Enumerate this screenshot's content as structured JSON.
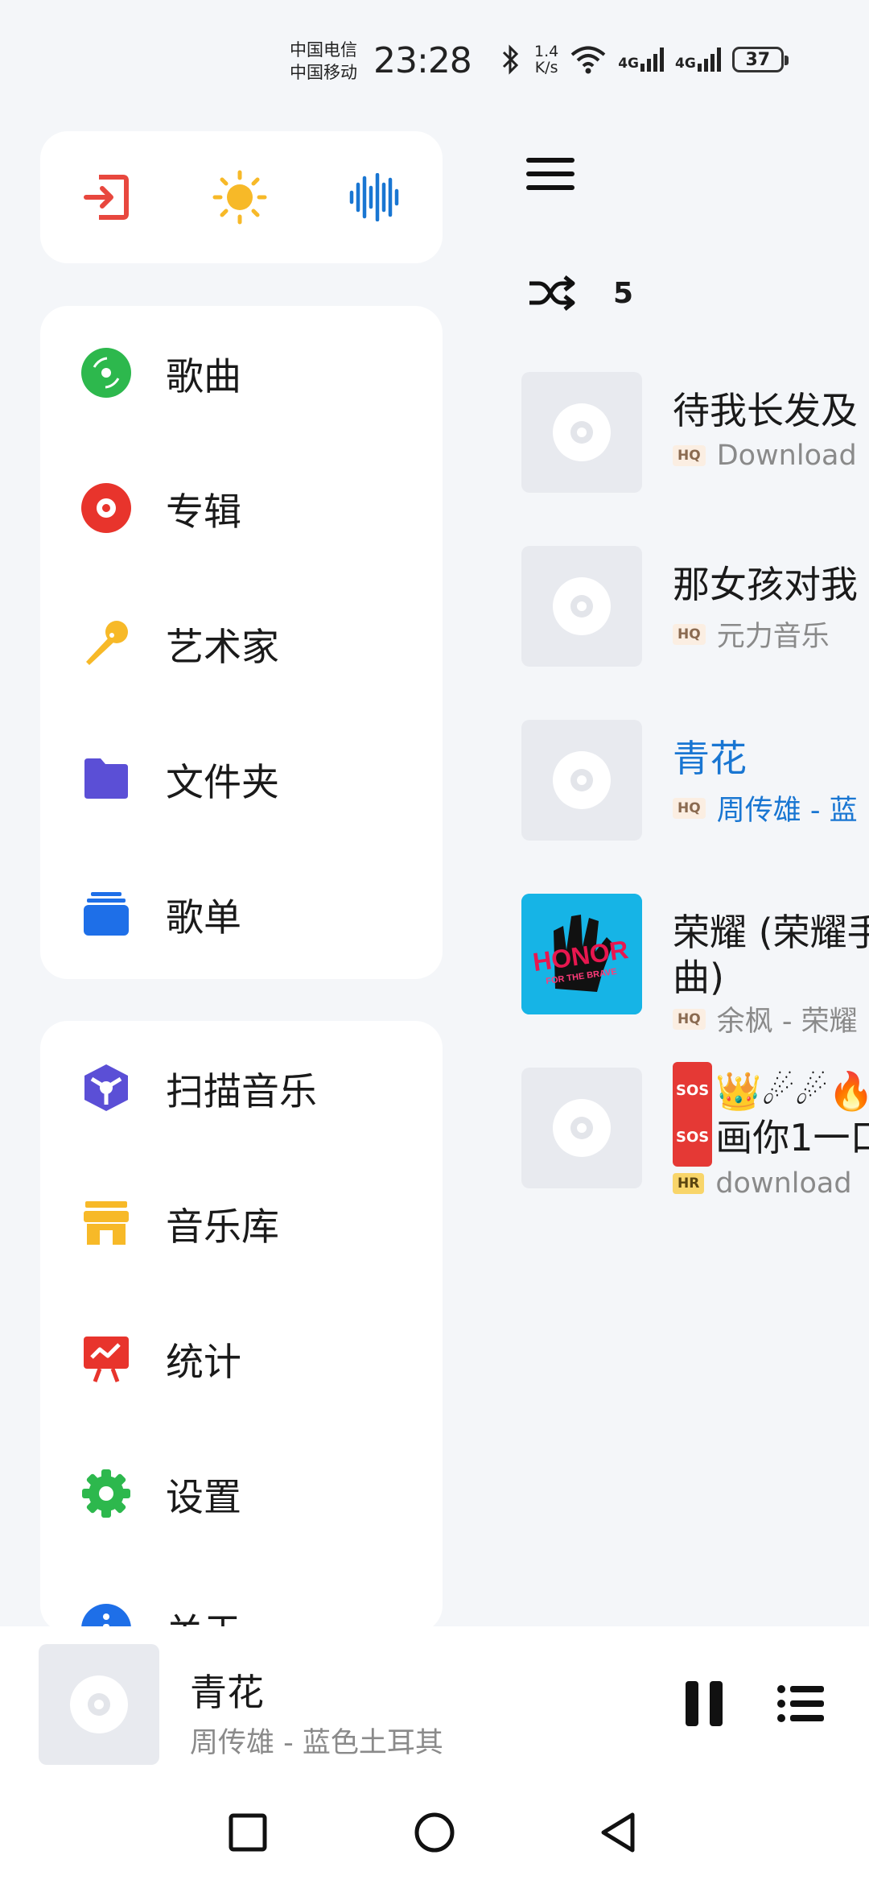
{
  "status_bar": {
    "carrier1": "中国电信",
    "carrier2": "中国移动",
    "time": "23:28",
    "net_speed_value": "1.4",
    "net_speed_unit": "K/s",
    "sim1_label": "4G",
    "sim2_label": "4G",
    "battery": "37"
  },
  "quick_actions": [
    {
      "icon": "exit-icon",
      "color": "#e8473e"
    },
    {
      "icon": "sun-icon",
      "color": "#f7b928"
    },
    {
      "icon": "audio-waveform-icon",
      "color": "#1976d2"
    }
  ],
  "drawer": {
    "library_items": [
      {
        "label": "歌曲",
        "icon": "song-disc-icon",
        "color": "#2db84d"
      },
      {
        "label": "专辑",
        "icon": "album-icon",
        "color": "#e8342c"
      },
      {
        "label": "艺术家",
        "icon": "microphone-icon",
        "color": "#f7b928"
      },
      {
        "label": "文件夹",
        "icon": "folder-icon",
        "color": "#5b4fd6"
      },
      {
        "label": "歌单",
        "icon": "playlist-icon",
        "color": "#1e6fe8"
      }
    ],
    "tool_items": [
      {
        "label": "扫描音乐",
        "icon": "scan-cube-icon",
        "color": "#5b4fd6"
      },
      {
        "label": "音乐库",
        "icon": "store-icon",
        "color": "#f7b928"
      },
      {
        "label": "统计",
        "icon": "stats-board-icon",
        "color": "#e8342c"
      },
      {
        "label": "设置",
        "icon": "gear-icon",
        "color": "#2db84d"
      },
      {
        "label": "关于",
        "icon": "info-icon",
        "color": "#1e6fe8"
      }
    ]
  },
  "song_list": {
    "shuffle_count": "5",
    "songs": [
      {
        "title": "待我长发及",
        "badge": "HQ",
        "subtitle": "Download",
        "active": false
      },
      {
        "title": "那女孩对我",
        "badge": "HQ",
        "subtitle": "元力音乐",
        "active": false
      },
      {
        "title": "青花",
        "badge": "HQ",
        "subtitle": "周传雄 - 蓝",
        "active": true
      },
      {
        "title": "荣耀 (荣耀手",
        "title2": "曲)",
        "badge": "HQ",
        "subtitle": "余枫 - 荣耀",
        "active": false
      },
      {
        "title": "👑☄☄🔥",
        "title2": "画你1一口",
        "badge": "HR",
        "subtitle": "download",
        "active": false
      }
    ]
  },
  "now_playing": {
    "title": "青花",
    "subtitle": "周传雄 - 蓝色土耳其"
  },
  "album_art": {
    "sos": "SOS",
    "honor": "HONOR",
    "honor_sub": "FOR THE BRAVE"
  }
}
